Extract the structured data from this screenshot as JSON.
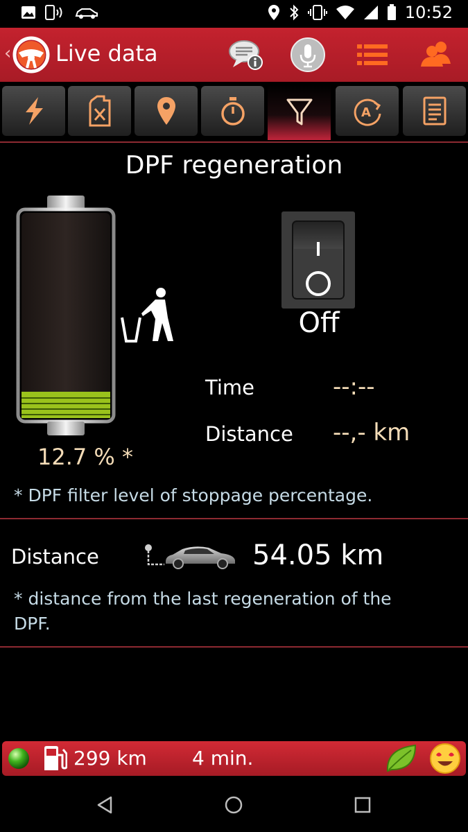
{
  "status_bar": {
    "time": "10:52",
    "left_icons": [
      "image-icon",
      "phone-signal-icon",
      "car-icon"
    ],
    "right_icons": [
      "location-icon",
      "bluetooth-icon",
      "vibrate-icon",
      "wifi-icon",
      "cell-signal-icon",
      "battery-icon"
    ]
  },
  "app_bar": {
    "back_glyph": "‹",
    "title": "Live data",
    "actions": [
      "chat-info-icon",
      "microphone-icon",
      "menu-list-icon",
      "user-icon"
    ]
  },
  "tabs": [
    {
      "icon": "lightning-icon",
      "active": false
    },
    {
      "icon": "fuel-canister-icon",
      "active": false
    },
    {
      "icon": "map-pin-icon",
      "active": false
    },
    {
      "icon": "stopwatch-icon",
      "active": false
    },
    {
      "icon": "filter-icon",
      "active": true
    },
    {
      "icon": "auto-icon",
      "active": false
    },
    {
      "icon": "document-icon",
      "active": false
    }
  ],
  "dpf": {
    "title": "DPF regeneration",
    "filter_level_percent": 12.7,
    "filter_level_text": "12.7 % *",
    "switch_state": "Off",
    "time_label": "Time",
    "time_value": "--:--",
    "distance_label": "Distance",
    "distance_value": "--,- km",
    "footnote": "* DPF filter level of stoppage percentage."
  },
  "last_regen": {
    "label": "Distance",
    "value": "54.05 km",
    "footnote_line1": "* distance from the last regeneration of the",
    "footnote_line2": "DPF."
  },
  "bottom_bar": {
    "range": "299 km",
    "duration": "4 min.",
    "icons": [
      "status-dot-icon",
      "fuel-pump-icon",
      "leaf-icon",
      "smiley-icon"
    ]
  },
  "colors": {
    "accent_red": "#c4222e",
    "value_text": "#f4dcb7",
    "footnote_text": "#c6dbe6",
    "battery_fill": "#9ac21c"
  }
}
